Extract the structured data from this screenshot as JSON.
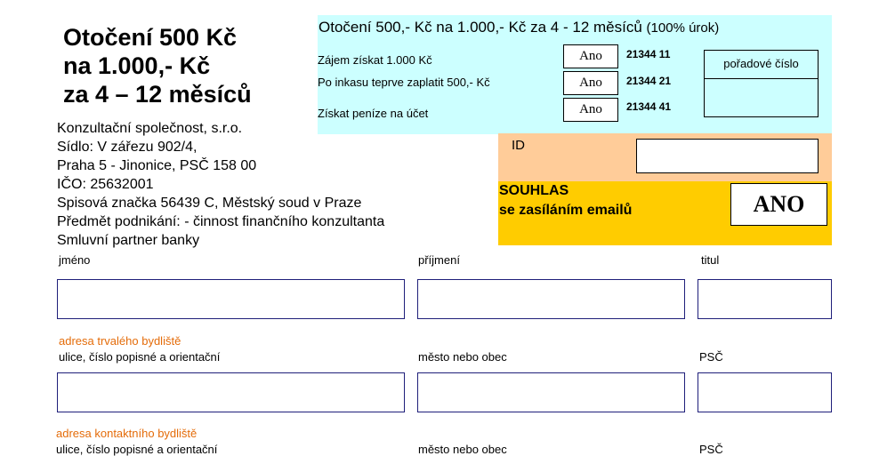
{
  "title": {
    "line1": "Otočení 500 Kč",
    "line2": "na 1.000,- Kč",
    "line3": "za 4 – 12 měsíců"
  },
  "company": {
    "name": "Konzultační společnost, s.r.o.",
    "address1": "Sídlo: V zářezu 902/4,",
    "address2": "Praha 5 - Jinonice, PSČ 158 00",
    "ico": "IČO: 25632001",
    "registration": "Spisová značka 56439 C, Městský soud v Praze",
    "business": "Předmět podnikání: - činnost finančního konzultanta",
    "partner": "Smluvní partner banky"
  },
  "offer": {
    "heading": "Otočení 500,- Kč na 1.000,- Kč za 4 - 12 měsíců",
    "heading_note": "(100% úrok)",
    "options": [
      {
        "label": "Zájem získat 1.000 Kč",
        "value": "Ano",
        "code": "21344  11"
      },
      {
        "label": "Po inkasu teprve zaplatit 500,- Kč",
        "value": "Ano",
        "code": "21344  21"
      },
      {
        "label": "Získat peníze na účet",
        "value": "Ano",
        "code": "21344  41"
      }
    ],
    "serial_label": "pořadové  číslo"
  },
  "id_section": {
    "label": "ID"
  },
  "consent": {
    "line1": "SOUHLAS",
    "line2": "se zasíláním emailů",
    "value": "ANO"
  },
  "form": {
    "name_label": "jméno",
    "surname_label": "příjmení",
    "title_label": "titul",
    "permanent_heading": "adresa trvalého bydliště",
    "street_label": "ulice, číslo popisné a orientační",
    "city_label": "město nebo obec",
    "zip_label": "PSČ",
    "contact_heading": "adresa kontaktního bydliště",
    "contact_street_label": "ulice, číslo popisné a orientační",
    "contact_city_label": "město nebo obec",
    "contact_zip_label": "PSČ"
  },
  "colors": {
    "cyan_panel": "#ccffff",
    "peach_panel": "#ffcc99",
    "consent_panel": "#ffcc00",
    "section_heading": "#e46c0a",
    "field_border": "#1f1f7a"
  }
}
